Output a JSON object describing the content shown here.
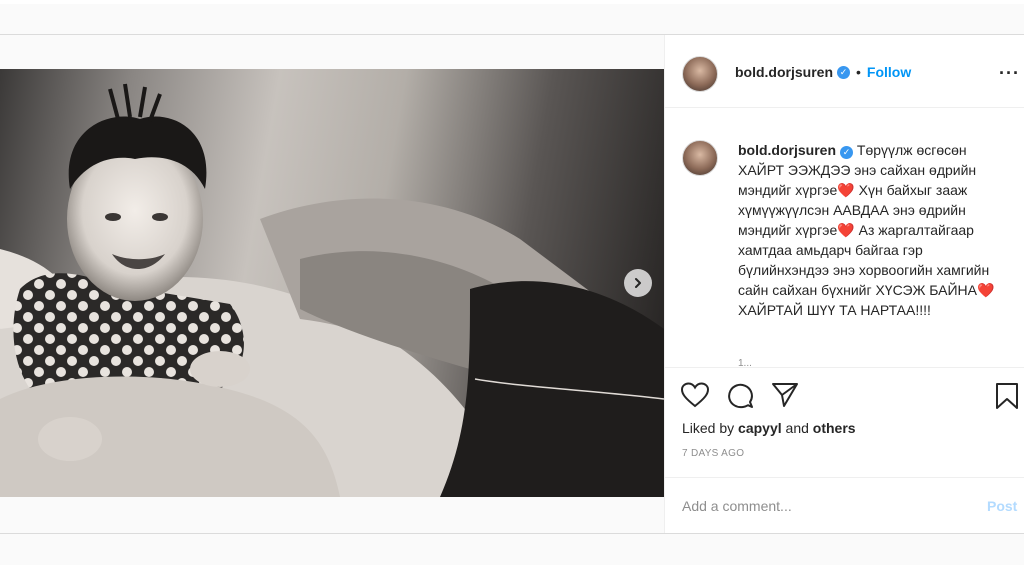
{
  "post": {
    "author": "bold.dorjsuren",
    "follow_label": "Follow",
    "separator": "•",
    "more_label": "···",
    "caption": "Төрүүлж өсгөсөн ХАЙРТ ЭЭЖДЭЭ энэ сайхан өдрийн мэндийг хүргэе❤️ Хүн байхыг зааж хүмүүжүүлсэн ААВДАА энэ өдрийн мэндийг хүргэе❤️ Аз жаргалтайгаар хамтдаа амьдарч байгаа гэр бүлийнхэндээ энэ хорвоогийн хамгийн сайн сайхан бүхнийг ХҮСЭЖ БАЙНА❤️\nХАЙРТАЙ ШҮҮ ТА НАРТАА!!!!",
    "caption_time_clipped": "1...",
    "likes_prefix": "Liked by",
    "liked_by_user": "capyyl",
    "likes_and": "and",
    "likes_others": "others",
    "timestamp": "7 DAYS AGO",
    "comment_placeholder": "Add a comment...",
    "post_button": "Post"
  }
}
